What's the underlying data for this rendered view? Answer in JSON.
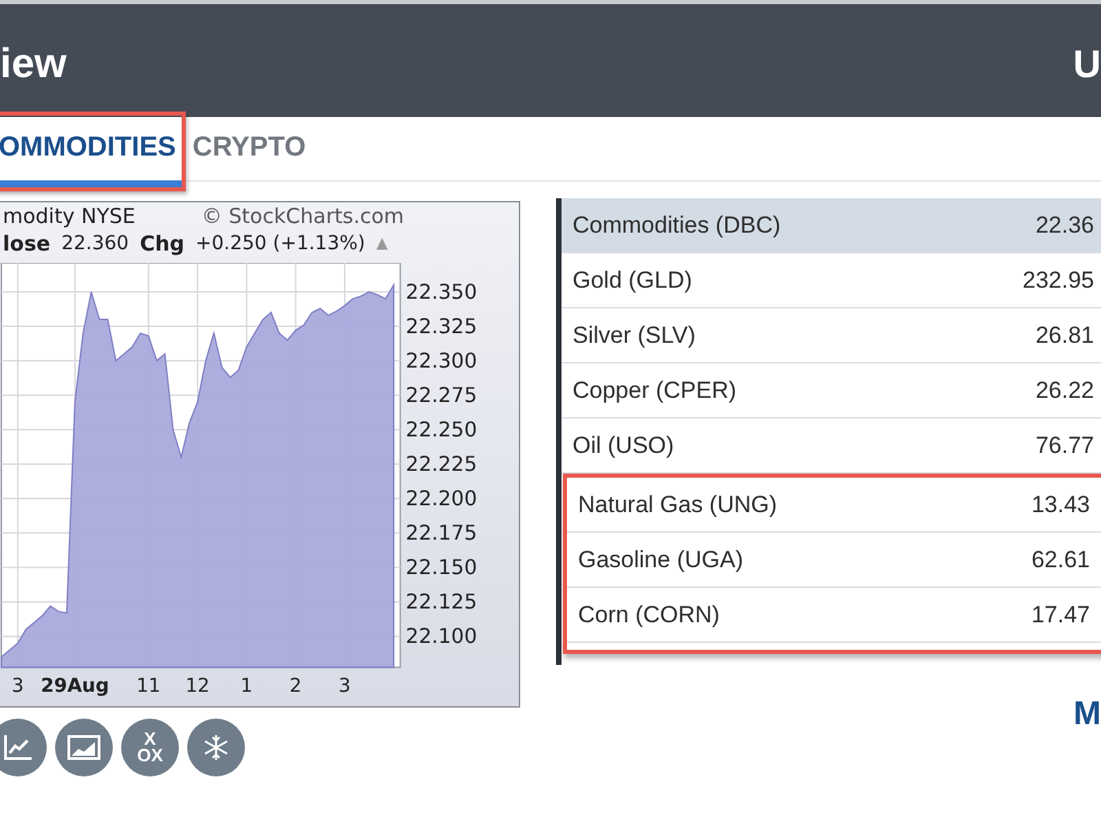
{
  "header": {
    "title": "iew",
    "right_text": "U"
  },
  "tabs": [
    {
      "label": "OMMODITIES",
      "selected": true,
      "highlighted": true
    },
    {
      "label": "CRYPTO",
      "selected": false,
      "highlighted": false
    }
  ],
  "chart": {
    "line1": "modity NYSE",
    "source": "© StockCharts.com",
    "close_label": "lose",
    "close_value": "22.360",
    "chg_label": "Chg",
    "chg_value": "+0.250 (+1.13%)",
    "trend_marker": "▲",
    "chart_data": {
      "type": "area",
      "grid": true,
      "ylim": [
        22.0775,
        22.371
      ],
      "yticks": [
        {
          "value": 22.1,
          "label": "22.100"
        },
        {
          "value": 22.125,
          "label": "22.125"
        },
        {
          "value": 22.15,
          "label": "22.150"
        },
        {
          "value": 22.175,
          "label": "22.175"
        },
        {
          "value": 22.2,
          "label": "22.200"
        },
        {
          "value": 22.225,
          "label": "22.225"
        },
        {
          "value": 22.25,
          "label": "22.250"
        },
        {
          "value": 22.275,
          "label": "22.275"
        },
        {
          "value": 22.3,
          "label": "22.300"
        },
        {
          "value": 22.325,
          "label": "22.325"
        },
        {
          "value": 22.35,
          "label": "22.350"
        }
      ],
      "categories": [
        null,
        null,
        "3",
        null,
        null,
        null,
        null,
        null,
        null,
        "29Aug",
        null,
        null,
        null,
        null,
        null,
        null,
        null,
        null,
        "11",
        null,
        null,
        null,
        null,
        null,
        "12",
        null,
        null,
        null,
        null,
        null,
        "1",
        null,
        null,
        null,
        null,
        null,
        "2",
        null,
        null,
        null,
        null,
        null,
        "3",
        null,
        null,
        null,
        null,
        null,
        null
      ],
      "series": [
        {
          "color": "#a9a9dc",
          "values": [
            22.085,
            22.09,
            22.095,
            22.105,
            22.11,
            22.115,
            22.122,
            22.118,
            22.117,
            22.27,
            22.32,
            22.35,
            22.33,
            22.33,
            22.3,
            22.305,
            22.31,
            22.32,
            22.318,
            22.3,
            22.305,
            22.25,
            22.23,
            22.255,
            22.27,
            22.3,
            22.32,
            22.295,
            22.288,
            22.293,
            22.31,
            22.32,
            22.33,
            22.335,
            22.32,
            22.315,
            22.322,
            22.326,
            22.335,
            22.338,
            22.333,
            22.336,
            22.34,
            22.345,
            22.347,
            22.35,
            22.348,
            22.345,
            22.355
          ]
        }
      ]
    }
  },
  "chart_tools": [
    {
      "kind": "line"
    },
    {
      "kind": "area"
    },
    {
      "kind": "pnf",
      "glyphs": [
        "X",
        "OX"
      ]
    },
    {
      "kind": "snowflake"
    }
  ],
  "table": {
    "rows": [
      {
        "name": "Commodities (DBC)",
        "price": "22.36",
        "selected": true,
        "highlighted": false
      },
      {
        "name": "Gold (GLD)",
        "price": "232.95",
        "selected": false,
        "highlighted": false
      },
      {
        "name": "Silver (SLV)",
        "price": "26.81",
        "selected": false,
        "highlighted": false
      },
      {
        "name": "Copper (CPER)",
        "price": "26.22",
        "selected": false,
        "highlighted": false
      },
      {
        "name": "Oil (USO)",
        "price": "76.77",
        "selected": false,
        "highlighted": false
      },
      {
        "name": "Natural Gas (UNG)",
        "price": "13.43",
        "selected": false,
        "highlighted": true
      },
      {
        "name": "Gasoline (UGA)",
        "price": "62.61",
        "selected": false,
        "highlighted": true
      },
      {
        "name": "Corn (CORN)",
        "price": "17.47",
        "selected": false,
        "highlighted": true
      }
    ]
  },
  "more_link": "M"
}
